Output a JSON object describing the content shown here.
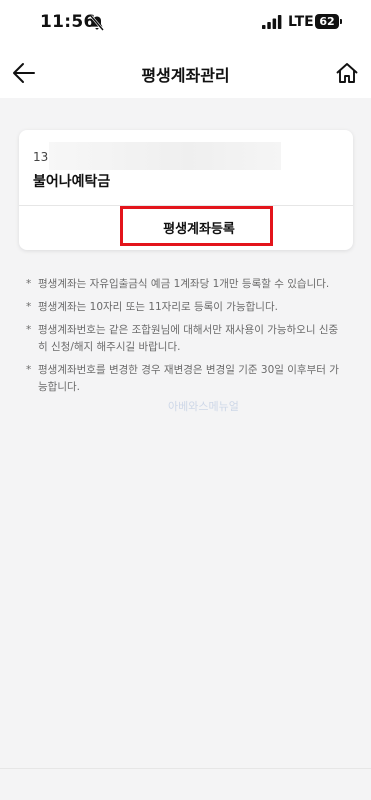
{
  "status_bar": {
    "time": "11:56",
    "network": "LTE",
    "battery": "62"
  },
  "header": {
    "title": "평생계좌관리"
  },
  "account": {
    "number_prefix": "13",
    "name": "불어나예탁금"
  },
  "register_button_label": "평생계좌등록",
  "notes": [
    "평생계좌는 자유입출금식 예금 1계좌당 1개만 등록할 수 있습니다.",
    "평생계좌는 10자리 또는 11자리로 등록이 가능합니다.",
    "평생계좌번호는 같은 조합원님에 대해서만 재사용이 가능하오니 신중히 신청/해지 해주시길 바랍니다.",
    "평생계좌번호를 변경한 경우 재변경은 변경일 기준 30일 이후부터 가능합니다."
  ],
  "note_bullet": "*",
  "watermark": "아베와스메뉴얼",
  "colors": {
    "highlight": "#e3141b",
    "page_background": "#f4f4f5",
    "note_text": "#6b6b6b"
  },
  "icons": {
    "back": "arrow-left-icon",
    "home": "home-icon",
    "mute": "bell-off-icon",
    "signal": "signal-icon"
  }
}
